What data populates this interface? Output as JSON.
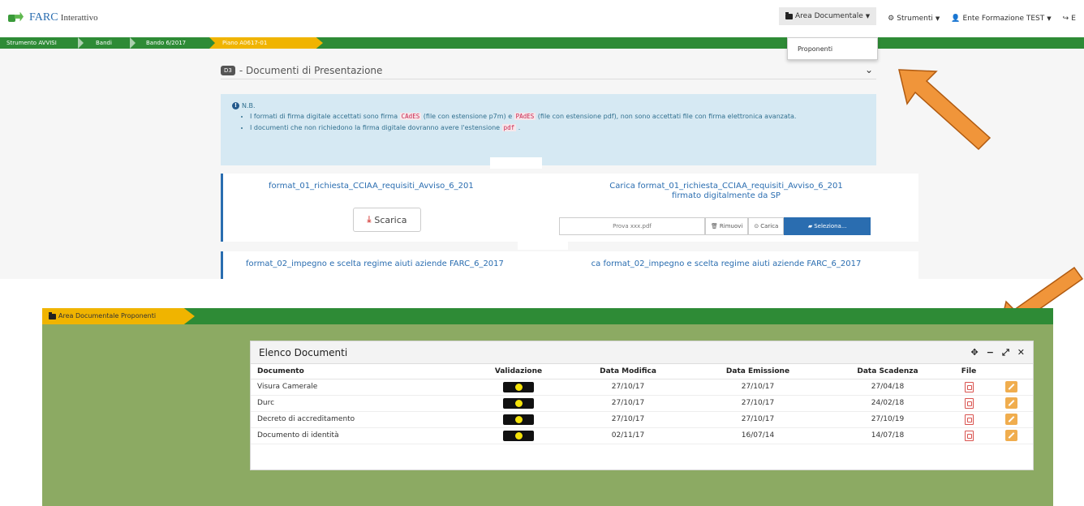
{
  "app": {
    "logo_name": "FARC",
    "logo_sub": "Interattivo"
  },
  "nav": {
    "area_documentale": "Area Documentale",
    "strumenti": "Strumenti",
    "ente": "Ente Formazione TEST",
    "logout": "E",
    "dropdown_item": "Proponenti"
  },
  "breadcrumb": {
    "items": [
      "Strumento AVVISI",
      "Bandi",
      "Bando 6/2017"
    ],
    "active": "Piano A0617-01"
  },
  "section": {
    "badge": "D3",
    "title": "- Documenti di Presentazione"
  },
  "note": {
    "title": "N.B.",
    "line1_a": "I formati di firma digitale accettati sono firma",
    "line1_tag1": "CAdES",
    "line1_b": "(file con estensione p7m) e",
    "line1_tag2": "PAdES",
    "line1_c": "(file con estensione pdf), non sono accettati file con firma elettronica avanzata.",
    "line2_a": "I documenti che non richiedono la firma digitale dovranno avere l'estensione",
    "line2_tag": "pdf",
    "line2_b": "."
  },
  "documents_top": [
    {
      "name": "format_01_richiesta_CCIAA_requisiti_Avviso_6_201",
      "upload_title_1": "Carica format_01_richiesta_CCIAA_requisiti_Avviso_6_201",
      "upload_title_2": "firmato digitalmente da SP",
      "download_label": "Scarica",
      "file_value": "Prova xxx.pdf",
      "remove_label": "Rimuovi",
      "upload_label": "Carica",
      "select_label": "Seleziona..."
    },
    {
      "name": "format_02_impegno e scelta regime aiuti aziende FARC_6_2017",
      "upload_title_1": "ca format_02_impegno e scelta regime aiuti aziende FARC_6_2017"
    }
  ],
  "bottom": {
    "tab_label": "Area Documentale Proponenti",
    "widget_title": "Elenco Documenti",
    "tools": [
      "✥",
      "−",
      "⤢",
      "✕"
    ],
    "columns": [
      "Documento",
      "Validazione",
      "Data Modifica",
      "Data Emissione",
      "Data Scadenza",
      "File"
    ],
    "rows": [
      {
        "documento": "Visura Camerale",
        "modifica": "27/10/17",
        "emissione": "27/10/17",
        "scadenza": "27/04/18"
      },
      {
        "documento": "Durc",
        "modifica": "27/10/17",
        "emissione": "27/10/17",
        "scadenza": "24/02/18"
      },
      {
        "documento": "Decreto di accreditamento",
        "modifica": "27/10/17",
        "emissione": "27/10/17",
        "scadenza": "27/10/19"
      },
      {
        "documento": "Documento di identità",
        "modifica": "02/11/17",
        "emissione": "16/07/14",
        "scadenza": "14/07/18"
      }
    ]
  },
  "colors": {
    "green_bar": "#2e8b36",
    "amber": "#f0b400",
    "arrow": "#f0953a",
    "bottom_bg": "#8caa63"
  }
}
